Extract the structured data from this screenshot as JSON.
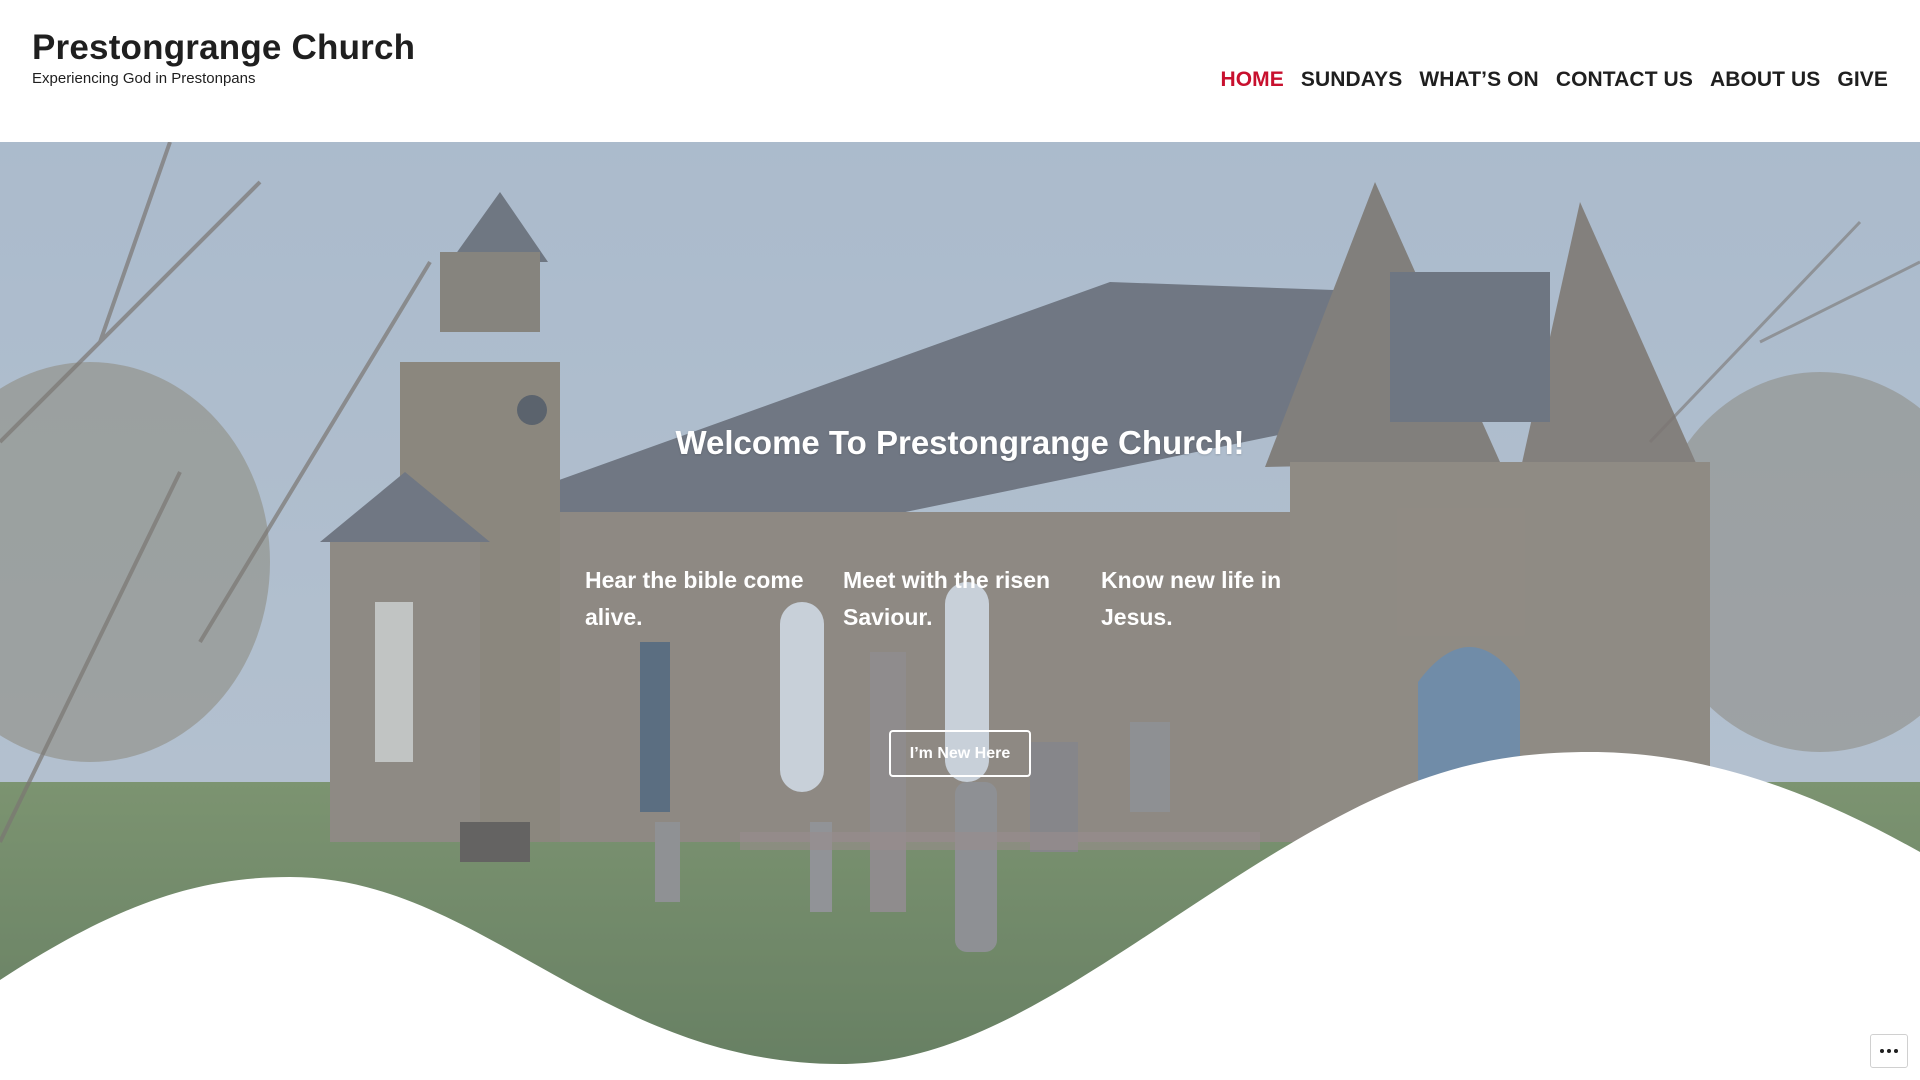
{
  "site": {
    "title": "Prestongrange Church",
    "tagline": "Experiencing God in Prestonpans"
  },
  "nav": {
    "items": [
      {
        "label": "HOME",
        "active": true
      },
      {
        "label": "SUNDAYS",
        "active": false
      },
      {
        "label": "WHAT’S ON",
        "active": false
      },
      {
        "label": "CONTACT US",
        "active": false
      },
      {
        "label": "ABOUT US",
        "active": false
      },
      {
        "label": "GIVE",
        "active": false
      }
    ]
  },
  "hero": {
    "heading": "Welcome To Prestongrange Church!",
    "columns": [
      "Hear the bible come alive.",
      "Meet with the risen Saviour.",
      "Know new life in Jesus."
    ],
    "cta_label": "I’m New Here",
    "background_icon": "church-photo"
  },
  "widget": {
    "icon": "more-options-icon"
  },
  "colors": {
    "accent": "#c8102e",
    "text": "#1f1f1f",
    "overlay": "#96a5b9"
  }
}
